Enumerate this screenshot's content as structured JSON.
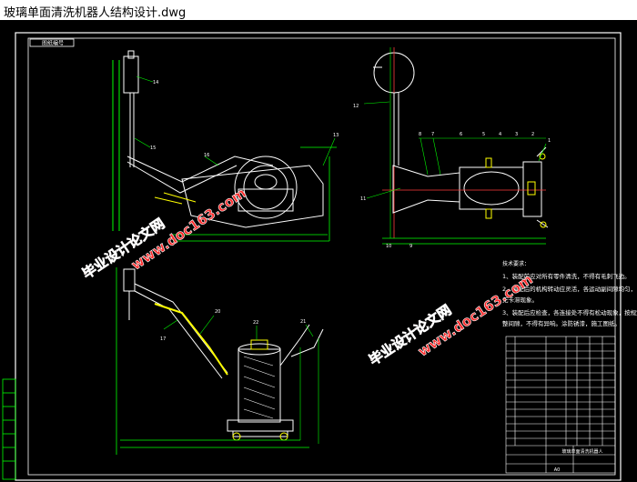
{
  "window": {
    "title": "玻璃单面清洗机器人结构设计.dwg"
  },
  "drawing": {
    "frame_tag": "图纸编号",
    "tech_requirements": {
      "heading": "技术要求：",
      "lines": [
        "1、装配前应对所有零件清洗，不得有毛刺飞边。",
        "2、装配后的机构转动应灵活，各运动副间隙均匀，",
        "   无卡滞现象。",
        "3、装配后应检查，各连接处不得有松动现象，按规定调",
        "   整间隙，不得有异响。涂防锈漆，施工图纸。"
      ]
    },
    "part_numbers": [
      "1",
      "2",
      "3",
      "4",
      "5",
      "6",
      "7",
      "8",
      "9",
      "10",
      "11",
      "12",
      "13",
      "14",
      "15",
      "16",
      "17",
      "18",
      "19",
      "20",
      "21",
      "22"
    ],
    "title_block": {
      "drawing_name": "玻璃单面清洗机器人",
      "scale": "A0"
    },
    "watermarks": [
      "毕业设计论文网",
      "www.doc163.com"
    ],
    "colors": {
      "background": "#000000",
      "frame": "#ffffff",
      "outline": "#00ff00",
      "center": "#ff3b3b",
      "dim": "#ffffff",
      "parts": "#ffff00",
      "watermark": "#ff2a2a"
    }
  }
}
